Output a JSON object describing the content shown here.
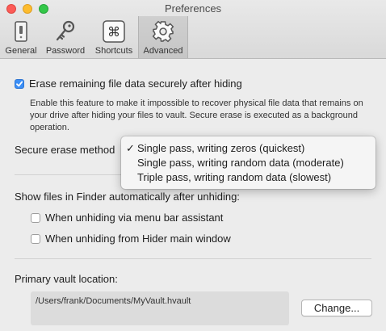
{
  "window": {
    "title": "Preferences"
  },
  "toolbar": {
    "tabs": [
      {
        "label": "General",
        "icon": "switch-icon"
      },
      {
        "label": "Password",
        "icon": "key-icon"
      },
      {
        "label": "Shortcuts",
        "icon": "command-key-icon"
      },
      {
        "label": "Advanced",
        "icon": "gear-icon",
        "selected": true
      }
    ]
  },
  "advanced": {
    "erase_secure": {
      "label": "Erase remaining file data securely after hiding",
      "checked": true,
      "description": "Enable this feature to make it impossible to recover physical file data that remains on your drive after hiding your files to vault. Secure erase is executed as a background operation."
    },
    "secure_erase_method": {
      "label": "Secure erase method",
      "selected_index": 0,
      "selected_mark": "✓",
      "options": [
        "Single pass, writing zeros (quickest)",
        "Single pass, writing random data (moderate)",
        "Triple pass, writing random data (slowest)"
      ]
    },
    "show_files": {
      "label": "Show files in Finder automatically after unhiding:",
      "options": [
        {
          "label": "When unhiding via menu bar assistant",
          "checked": false
        },
        {
          "label": "When unhiding from Hider main window",
          "checked": false
        }
      ]
    },
    "vault": {
      "label": "Primary vault location:",
      "path": "/Users/frank/Documents/MyVault.hvault",
      "change_button": "Change..."
    }
  },
  "colors": {
    "accent": "#3a8ef6",
    "window_bg": "#ececec"
  }
}
